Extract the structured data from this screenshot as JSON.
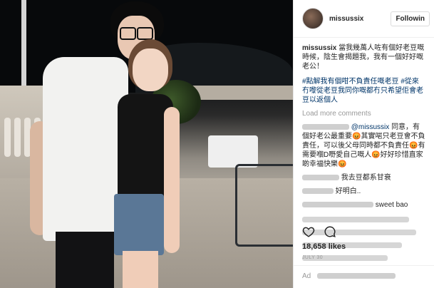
{
  "post": {
    "username": "missussix",
    "follow_label": "Followin",
    "caption": "當我幾萬人咗有個好老豆嘅時候，陰生會揭題我，我有一個好好嘅老公！",
    "tags": "#點解我有個咁不負責任嘅老豆 #從來冇嚟從老豆我同你嘅都冇只希望佢會老豆以返個人",
    "load_more": "Load more comments",
    "comments": [
      {
        "user": "",
        "mention": "@missussix",
        "text": "同意，有個好老公最重要😡其實啱只老豆會不負責任，可以後父母同時都不負責任😡有需要嗰D嘢愛自己嘅人😡好好珍惜直家啲幸福快樂😡"
      },
      {
        "user": "",
        "text": "我去豆都系甘衰"
      },
      {
        "user": "",
        "text": "好明白.."
      },
      {
        "user": "",
        "text": "sweet bao"
      }
    ],
    "likes": "18,658 likes",
    "date": "JULY 30",
    "add_comment": "Ad"
  },
  "icons": {
    "heart": "heart-icon",
    "comment": "comment-icon"
  },
  "colors": {
    "hashtag": "#003569",
    "muted": "#999999",
    "text": "#262626"
  }
}
